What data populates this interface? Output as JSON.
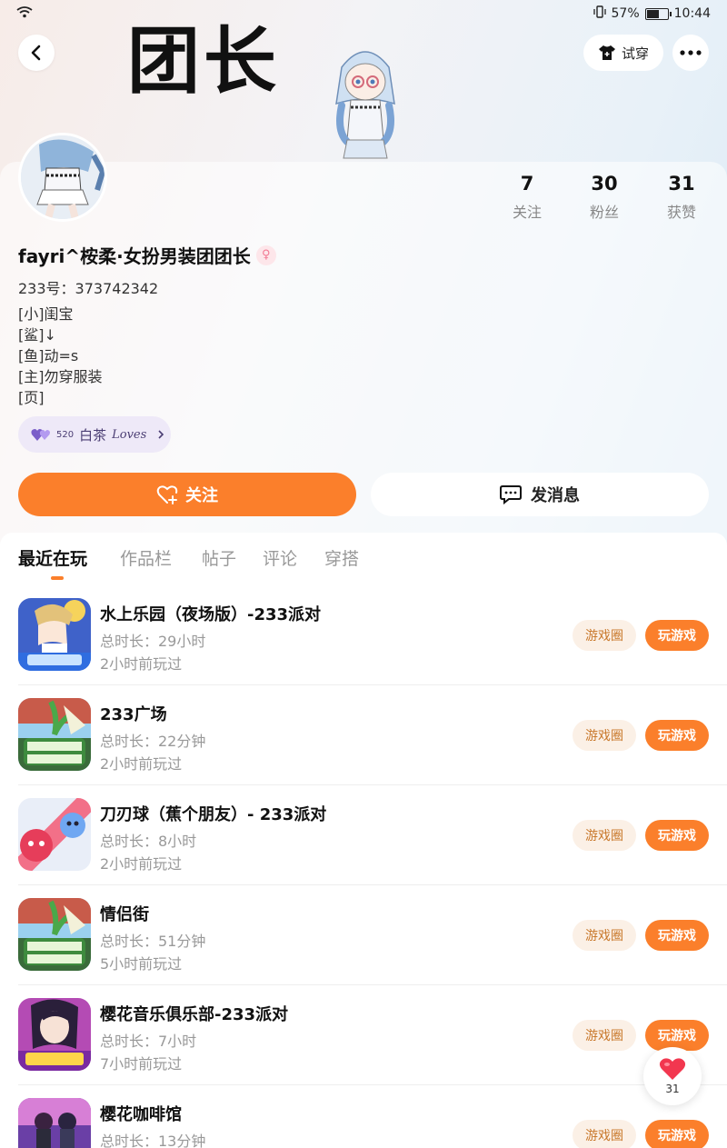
{
  "status_bar": {
    "battery": "57%",
    "time": "10:44"
  },
  "header": {
    "title": "团长",
    "tryon_label": "试穿"
  },
  "profile": {
    "stats": [
      {
        "num": "7",
        "label": "关注"
      },
      {
        "num": "30",
        "label": "粉丝"
      },
      {
        "num": "31",
        "label": "获赞"
      }
    ],
    "nickname": "fayri^桉柔·女扮男装团团长",
    "gender_symbol": "♀",
    "uid": "233号：373742342",
    "bio_lines": [
      "[小]闺宝",
      "[鲨]↓",
      "[鱼]动=s",
      "[主]勿穿服装",
      "[页]"
    ],
    "tag_pill": {
      "prefix": "520",
      "label": "白茶",
      "script": "Loves"
    },
    "follow_label": "关注",
    "message_label": "发消息"
  },
  "tabs": [
    "最近在玩",
    "作品栏",
    "帖子",
    "评论",
    "穿搭"
  ],
  "game_buttons": {
    "circle": "游戏圈",
    "play": "玩游戏"
  },
  "games": [
    {
      "title": "水上乐园（夜场版）-233派对",
      "duration": "总时长：29小时",
      "last_played": "2小时前玩过",
      "icon_name": "water-park-icon"
    },
    {
      "title": "233广场",
      "duration": "总时长：22分钟",
      "last_played": "2小时前玩过",
      "icon_name": "hello-world-icon"
    },
    {
      "title": "刀刃球（蕉个朋友）- 233派对",
      "duration": "总时长：8小时",
      "last_played": "2小时前玩过",
      "icon_name": "blade-ball-icon"
    },
    {
      "title": "情侣街",
      "duration": "总时长：51分钟",
      "last_played": "5小时前玩过",
      "icon_name": "hello-world-icon"
    },
    {
      "title": "樱花音乐俱乐部-233派对",
      "duration": "总时长：7小时",
      "last_played": "7小时前玩过",
      "icon_name": "sakura-music-icon"
    },
    {
      "title": "樱花咖啡馆",
      "duration": "总时长：13分钟",
      "last_played": "",
      "icon_name": "sakura-cafe-icon"
    }
  ],
  "like_fab": {
    "count": "31"
  },
  "colors": {
    "accent": "#fb7f2b",
    "circle_bg": "#fbf0e6",
    "circle_text": "#c9792c"
  }
}
